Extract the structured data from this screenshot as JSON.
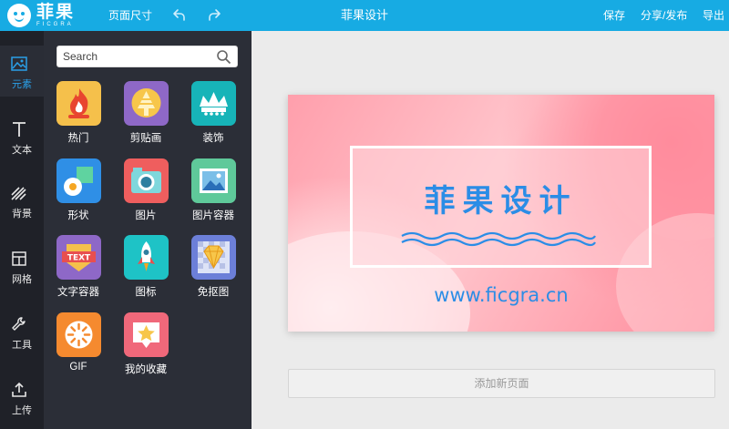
{
  "app": {
    "logo_text": "菲果",
    "logo_sub": "FICGRA",
    "page_size_label": "页面尺寸"
  },
  "document": {
    "title": "菲果设计"
  },
  "toolbar": {
    "save": "保存",
    "share": "分享/发布",
    "export": "导出"
  },
  "rail": [
    {
      "label": "元素",
      "icon": "image-icon",
      "active": true
    },
    {
      "label": "文本",
      "icon": "text-icon"
    },
    {
      "label": "背景",
      "icon": "stripes-icon"
    },
    {
      "label": "网格",
      "icon": "grid-icon"
    },
    {
      "label": "工具",
      "icon": "wrench-icon"
    },
    {
      "label": "上传",
      "icon": "upload-icon"
    }
  ],
  "panel": {
    "search_placeholder": "Search",
    "tiles": [
      {
        "label": "热门",
        "icon": "fire-icon",
        "color": "#f5c04b"
      },
      {
        "label": "剪贴画",
        "icon": "tree-icon",
        "color": "#8e68c7"
      },
      {
        "label": "装饰",
        "icon": "crown-icon",
        "color": "#17b4b8"
      },
      {
        "label": "形状",
        "icon": "shapes-icon",
        "color": "#2f8fe6"
      },
      {
        "label": "图片",
        "icon": "camera-icon",
        "color": "#ef5e5e"
      },
      {
        "label": "图片容器",
        "icon": "picture-frame-icon",
        "color": "#5fc99a"
      },
      {
        "label": "文字容器",
        "icon": "text-badge-icon",
        "color": "#8e68c7"
      },
      {
        "label": "图标",
        "icon": "rocket-icon",
        "color": "#1ec3c6"
      },
      {
        "label": "免抠图",
        "icon": "diamond-icon",
        "color": "#6c7fd8"
      },
      {
        "label": "GIF",
        "icon": "loading-icon",
        "color": "#f58a2f"
      },
      {
        "label": "我的收藏",
        "icon": "star-icon",
        "color": "#f0687a"
      }
    ]
  },
  "canvas": {
    "headline": "菲果设计",
    "url": "www.ficgra.cn",
    "add_page": "添加新页面"
  },
  "colors": {
    "topbar": "#17abe3",
    "accent_text": "#2b8de6",
    "arrow": "#e02020"
  }
}
